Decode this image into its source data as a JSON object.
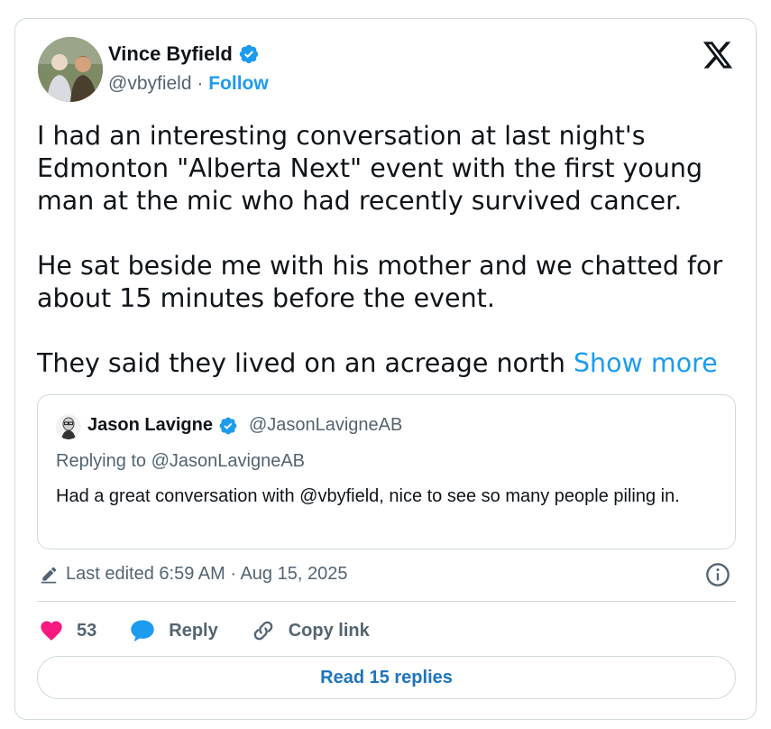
{
  "tweet": {
    "author": {
      "name": "Vince Byfield",
      "handle": "@vbyfield",
      "separator": "·",
      "follow_label": "Follow"
    },
    "body": [
      "I had an interesting conversation at last night's Edmonton \"Alberta Next\" event with the first young man at the mic who had recently survived cancer.",
      "He sat beside me with his mother and we chatted for about 15 minutes before the event.",
      "They said they lived on an acreage north"
    ],
    "show_more_label": "Show more",
    "quoted": {
      "author_name": "Jason Lavigne",
      "author_handle": "@JasonLavigneAB",
      "replying_to": "Replying to @JasonLavigneAB",
      "text": "Had a great conversation with @vbyfield, nice to see so many people piling in."
    },
    "edited_text": "Last edited 6:59 AM · Aug 15, 2025",
    "actions": {
      "likes": "53",
      "reply_label": "Reply",
      "copy_label": "Copy link"
    },
    "read_replies_label": "Read 15 replies"
  },
  "colors": {
    "accent": "#1d9bf0",
    "like": "#f91880",
    "muted": "#536471",
    "border": "#cfd9de"
  },
  "icons": [
    "verified-badge-icon",
    "x-logo-icon",
    "pencil-icon",
    "info-icon",
    "heart-icon",
    "reply-bubble-icon",
    "link-icon"
  ]
}
